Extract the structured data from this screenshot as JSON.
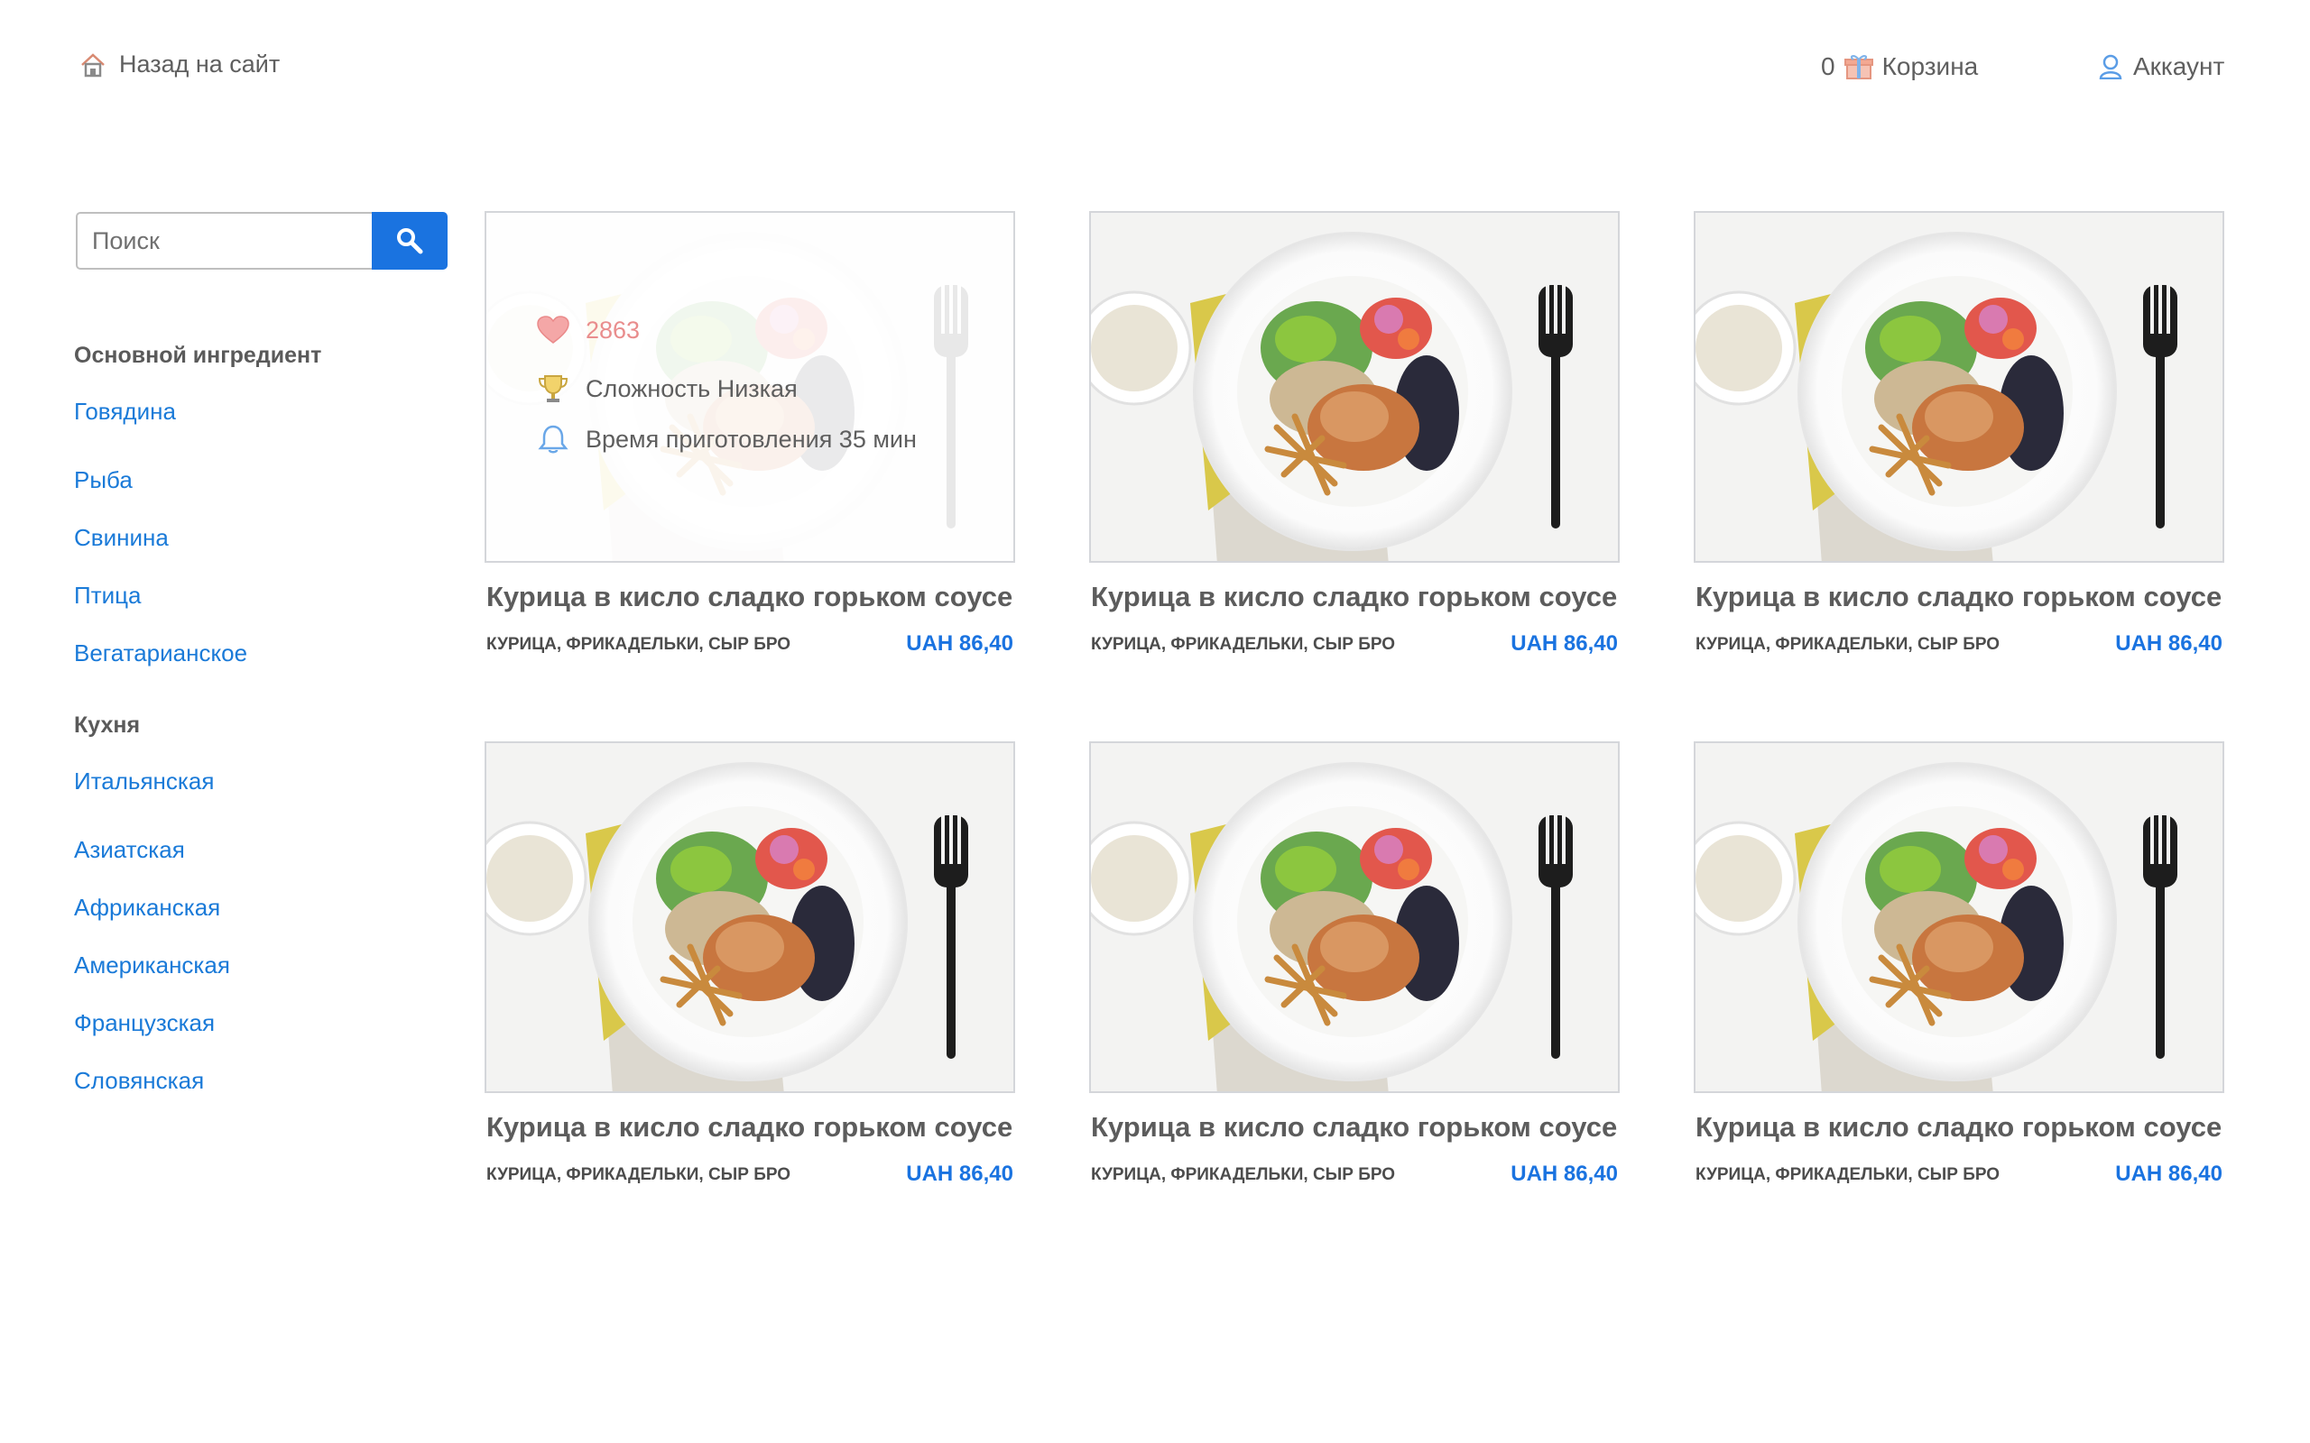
{
  "header": {
    "back_label": "Назад на сайт",
    "cart_count": "0",
    "cart_label": "Корзина",
    "account_label": "Аккаунт"
  },
  "search": {
    "placeholder": "Поиск"
  },
  "filters": {
    "ingredient_title": "Основной ингредиент",
    "ingredients": [
      "Говядина",
      "Рыба",
      "Свинина",
      "Птица",
      "Вегатарианское"
    ],
    "cuisine_title": "Кухня",
    "cuisines": [
      "Итальянская",
      "Азиатская",
      "Африканская",
      "Американская",
      "Французская",
      "Словянская"
    ]
  },
  "colors": {
    "accent": "#1a73e0",
    "link": "#1a7ad8",
    "likes": "#e98d8d"
  },
  "products": [
    {
      "title": "Курица в кисло сладко горьком соусе",
      "ingredients": "КУРИЦА, ФРИКАДЕЛЬКИ, СЫР БРО",
      "price": "UAH 86,40",
      "likes": "2863",
      "difficulty": "Сложность Низкая",
      "time": "Время приготовления 35 мин"
    },
    {
      "title": "Курица в кисло сладко горьком соусе",
      "ingredients": "КУРИЦА, ФРИКАДЕЛЬКИ, СЫР БРО",
      "price": "UAH 86,40"
    },
    {
      "title": "Курица в кисло сладко горьком соусе",
      "ingredients": "КУРИЦА, ФРИКАДЕЛЬКИ, СЫР БРО",
      "price": "UAH 86,40"
    },
    {
      "title": "Курица в кисло сладко горьком соусе",
      "ingredients": "КУРИЦА, ФРИКАДЕЛЬКИ, СЫР БРО",
      "price": "UAH 86,40"
    },
    {
      "title": "Курица в кисло сладко горьком соусе",
      "ingredients": "КУРИЦА, ФРИКАДЕЛЬКИ, СЫР БРО",
      "price": "UAH 86,40"
    },
    {
      "title": "Курица в кисло сладко горьком соусе",
      "ingredients": "КУРИЦА, ФРИКАДЕЛЬКИ, СЫР БРО",
      "price": "UAH 86,40"
    }
  ]
}
